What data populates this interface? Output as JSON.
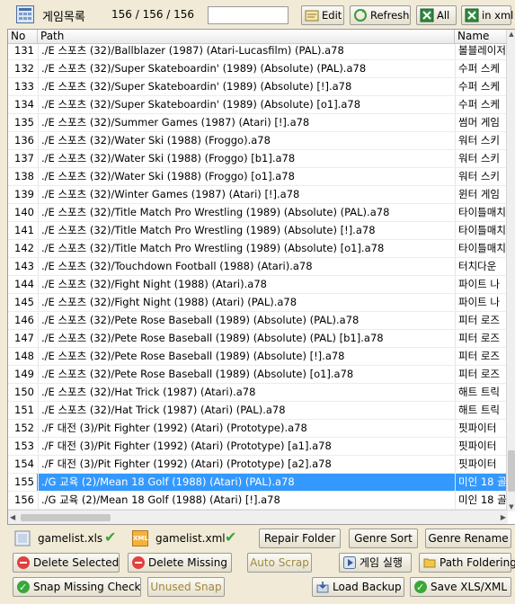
{
  "toolbar": {
    "title": "게임목록",
    "count": "156 / 156 / 156",
    "search_value": "",
    "edit_label": "Edit",
    "refresh_label": "Refresh",
    "all_label": "All",
    "inxml_label": "in xml"
  },
  "list": {
    "columns": {
      "no": "No",
      "path": "Path",
      "name": "Name"
    },
    "rows": [
      {
        "no": "131",
        "path": "./E 스포츠 (32)/Ballblazer (1987) (Atari-Lucasfilm) (PAL).a78",
        "name": "볼블레이저"
      },
      {
        "no": "132",
        "path": "./E 스포츠 (32)/Super Skateboardin' (1989) (Absolute) (PAL).a78",
        "name": "수퍼 스케"
      },
      {
        "no": "133",
        "path": "./E 스포츠 (32)/Super Skateboardin' (1989) (Absolute) [!].a78",
        "name": "수퍼 스케"
      },
      {
        "no": "134",
        "path": "./E 스포츠 (32)/Super Skateboardin' (1989) (Absolute) [o1].a78",
        "name": "수퍼 스케"
      },
      {
        "no": "135",
        "path": "./E 스포츠 (32)/Summer Games (1987) (Atari) [!].a78",
        "name": "썸머 게임"
      },
      {
        "no": "136",
        "path": "./E 스포츠 (32)/Water Ski (1988) (Froggo).a78",
        "name": "워터 스키"
      },
      {
        "no": "137",
        "path": "./E 스포츠 (32)/Water Ski (1988) (Froggo) [b1].a78",
        "name": "워터 스키"
      },
      {
        "no": "138",
        "path": "./E 스포츠 (32)/Water Ski (1988) (Froggo) [o1].a78",
        "name": "워터 스키"
      },
      {
        "no": "139",
        "path": "./E 스포츠 (32)/Winter Games (1987) (Atari) [!].a78",
        "name": "윈터 게임"
      },
      {
        "no": "140",
        "path": "./E 스포츠 (32)/Title Match Pro Wrestling (1989) (Absolute) (PAL).a78",
        "name": "타이틀매치"
      },
      {
        "no": "141",
        "path": "./E 스포츠 (32)/Title Match Pro Wrestling (1989) (Absolute) [!].a78",
        "name": "타이틀매치"
      },
      {
        "no": "142",
        "path": "./E 스포츠 (32)/Title Match Pro Wrestling (1989) (Absolute) [o1].a78",
        "name": "타이틀매치"
      },
      {
        "no": "143",
        "path": "./E 스포츠 (32)/Touchdown Football (1988) (Atari).a78",
        "name": "터치다운"
      },
      {
        "no": "144",
        "path": "./E 스포츠 (32)/Fight Night (1988) (Atari).a78",
        "name": "파이트 나"
      },
      {
        "no": "145",
        "path": "./E 스포츠 (32)/Fight Night (1988) (Atari) (PAL).a78",
        "name": "파이트 나"
      },
      {
        "no": "146",
        "path": "./E 스포츠 (32)/Pete Rose Baseball (1989) (Absolute) (PAL).a78",
        "name": "피터 로즈"
      },
      {
        "no": "147",
        "path": "./E 스포츠 (32)/Pete Rose Baseball (1989) (Absolute) (PAL) [b1].a78",
        "name": "피터 로즈"
      },
      {
        "no": "148",
        "path": "./E 스포츠 (32)/Pete Rose Baseball (1989) (Absolute) [!].a78",
        "name": "피터 로즈"
      },
      {
        "no": "149",
        "path": "./E 스포츠 (32)/Pete Rose Baseball (1989) (Absolute) [o1].a78",
        "name": "피터 로즈"
      },
      {
        "no": "150",
        "path": "./E 스포츠 (32)/Hat Trick (1987) (Atari).a78",
        "name": "해트 트릭"
      },
      {
        "no": "151",
        "path": "./E 스포츠 (32)/Hat Trick (1987) (Atari) (PAL).a78",
        "name": "해트 트릭"
      },
      {
        "no": "152",
        "path": "./F 대전 (3)/Pit Fighter (1992) (Atari) (Prototype).a78",
        "name": "핏파이터"
      },
      {
        "no": "153",
        "path": "./F 대전 (3)/Pit Fighter (1992) (Atari) (Prototype) [a1].a78",
        "name": "핏파이터"
      },
      {
        "no": "154",
        "path": "./F 대전 (3)/Pit Fighter (1992) (Atari) (Prototype) [a2].a78",
        "name": "핏파이터"
      },
      {
        "no": "155",
        "path": "./G 교육 (2)/Mean 18 Golf (1988) (Atari) (PAL).a78",
        "name": "미인 18 골"
      },
      {
        "no": "156",
        "path": "./G 교육 (2)/Mean 18 Golf (1988) (Atari) [!].a78",
        "name": "미인 18 골"
      }
    ],
    "selected_no": "155"
  },
  "files": {
    "xls_label": "gamelist.xls",
    "xml_label": "gamelist.xml",
    "xml_icon_text": "XML"
  },
  "buttons": {
    "repair_folder": "Repair Folder",
    "genre_sort": "Genre Sort",
    "genre_rename": "Genre Rename",
    "delete_selected": "Delete Selected",
    "delete_missing": "Delete Missing",
    "auto_scrap": "Auto Scrap",
    "game_run": "게임 실행",
    "path_foldering": "Path Foldering",
    "snap_missing_check": "Snap Missing Check",
    "unused_snap": "Unused Snap",
    "load_backup": "Load Backup",
    "save_xls_xml": "Save XLS/XML"
  },
  "colors": {
    "selection": "#3399ff",
    "window_bg": "#f0ead6",
    "check_green": "#3aa53a"
  }
}
